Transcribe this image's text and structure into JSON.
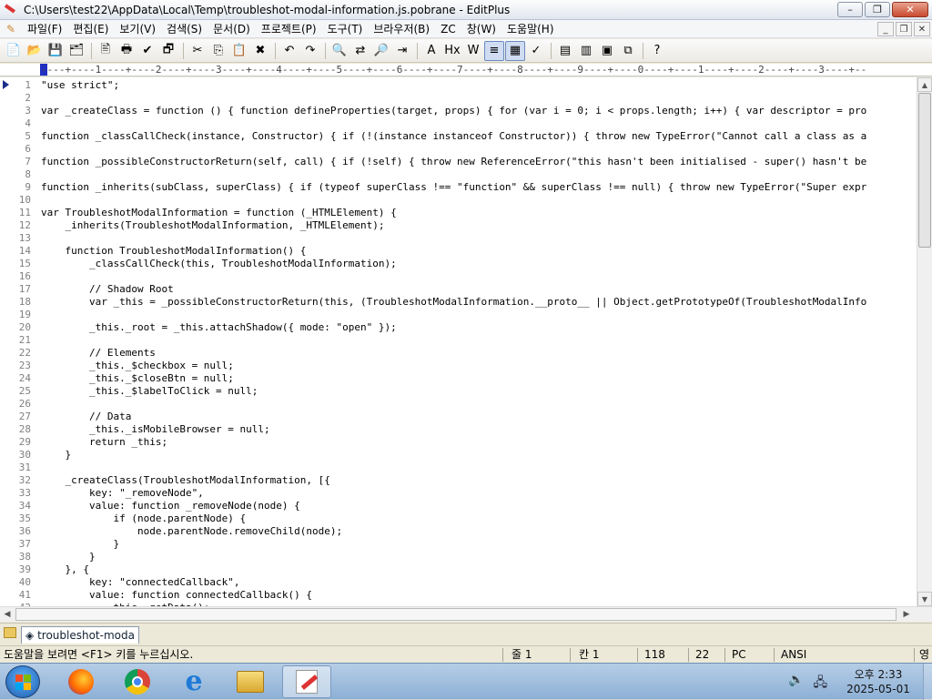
{
  "window": {
    "title": "C:\\Users\\test22\\AppData\\Local\\Temp\\troubleshot-modal-information.js.pobrane - EditPlus",
    "controls": {
      "minimize": "–",
      "maximize": "❐",
      "close": "✕"
    }
  },
  "menu": {
    "items": [
      "파일(F)",
      "편집(E)",
      "보기(V)",
      "검색(S)",
      "문서(D)",
      "프로젝트(P)",
      "도구(T)",
      "브라우저(B)",
      "ZC",
      "창(W)",
      "도움말(H)"
    ]
  },
  "mdi_controls": {
    "minimize": "_",
    "restore": "❐",
    "close": "✕"
  },
  "toolbar": {
    "buttons": [
      {
        "name": "new-file",
        "glyph": "📄"
      },
      {
        "name": "open-file",
        "glyph": "📂"
      },
      {
        "name": "save",
        "glyph": "💾"
      },
      {
        "name": "save-all",
        "glyph": "🗂"
      },
      {
        "name": "print-preview",
        "glyph": "🖹"
      },
      {
        "name": "print",
        "glyph": "🖶"
      },
      {
        "name": "spellcheck",
        "glyph": "✔"
      },
      {
        "name": "browser-view",
        "glyph": "🗗"
      },
      {
        "name": "cut",
        "glyph": "✂"
      },
      {
        "name": "copy",
        "glyph": "⎘"
      },
      {
        "name": "paste",
        "glyph": "📋"
      },
      {
        "name": "delete",
        "glyph": "✖"
      },
      {
        "name": "undo",
        "glyph": "↶"
      },
      {
        "name": "redo",
        "glyph": "↷"
      },
      {
        "name": "find",
        "glyph": "🔍"
      },
      {
        "name": "replace",
        "glyph": "⇄"
      },
      {
        "name": "find-in-files",
        "glyph": "🔎"
      },
      {
        "name": "goto",
        "glyph": "⇥"
      },
      {
        "name": "font",
        "glyph": "A"
      },
      {
        "name": "hex",
        "glyph": "Hx"
      },
      {
        "name": "word-wrap",
        "glyph": "W"
      },
      {
        "name": "line-number",
        "glyph": "≡"
      },
      {
        "name": "column-select",
        "glyph": "▦"
      },
      {
        "name": "check",
        "glyph": "✓"
      },
      {
        "name": "cliptext",
        "glyph": "▤"
      },
      {
        "name": "directory",
        "glyph": "▥"
      },
      {
        "name": "output",
        "glyph": "▣"
      },
      {
        "name": "fullscreen",
        "glyph": "⧉"
      },
      {
        "name": "help",
        "glyph": "?"
      }
    ]
  },
  "ruler": "----+----1----+----2----+----3----+----4----+----5----+----6----+----7----+----8----+----9----+----0----+----1----+----2----+----3----+--",
  "editor": {
    "lines": [
      {
        "n": "1",
        "t": "\"use strict\";"
      },
      {
        "n": "2",
        "t": ""
      },
      {
        "n": "3",
        "t": "var _createClass = function () { function defineProperties(target, props) { for (var i = 0; i < props.length; i++) { var descriptor = pro"
      },
      {
        "n": "4",
        "t": ""
      },
      {
        "n": "5",
        "t": "function _classCallCheck(instance, Constructor) { if (!(instance instanceof Constructor)) { throw new TypeError(\"Cannot call a class as a"
      },
      {
        "n": "6",
        "t": ""
      },
      {
        "n": "7",
        "t": "function _possibleConstructorReturn(self, call) { if (!self) { throw new ReferenceError(\"this hasn't been initialised - super() hasn't be"
      },
      {
        "n": "8",
        "t": ""
      },
      {
        "n": "9",
        "t": "function _inherits(subClass, superClass) { if (typeof superClass !== \"function\" && superClass !== null) { throw new TypeError(\"Super expr"
      },
      {
        "n": "10",
        "t": ""
      },
      {
        "n": "11",
        "t": "var TroubleshotModalInformation = function (_HTMLElement) {"
      },
      {
        "n": "12",
        "t": "    _inherits(TroubleshotModalInformation, _HTMLElement);"
      },
      {
        "n": "13",
        "t": ""
      },
      {
        "n": "14",
        "t": "    function TroubleshotModalInformation() {"
      },
      {
        "n": "15",
        "t": "        _classCallCheck(this, TroubleshotModalInformation);"
      },
      {
        "n": "16",
        "t": ""
      },
      {
        "n": "17",
        "t": "        // Shadow Root"
      },
      {
        "n": "18",
        "t": "        var _this = _possibleConstructorReturn(this, (TroubleshotModalInformation.__proto__ || Object.getPrototypeOf(TroubleshotModalInfo"
      },
      {
        "n": "19",
        "t": ""
      },
      {
        "n": "20",
        "t": "        _this._root = _this.attachShadow({ mode: \"open\" });"
      },
      {
        "n": "21",
        "t": ""
      },
      {
        "n": "22",
        "t": "        // Elements"
      },
      {
        "n": "23",
        "t": "        _this._$checkbox = null;"
      },
      {
        "n": "24",
        "t": "        _this._$closeBtn = null;"
      },
      {
        "n": "25",
        "t": "        _this._$labelToClick = null;"
      },
      {
        "n": "26",
        "t": ""
      },
      {
        "n": "27",
        "t": "        // Data"
      },
      {
        "n": "28",
        "t": "        _this._isMobileBrowser = null;"
      },
      {
        "n": "29",
        "t": "        return _this;"
      },
      {
        "n": "30",
        "t": "    }"
      },
      {
        "n": "31",
        "t": ""
      },
      {
        "n": "32",
        "t": "    _createClass(TroubleshotModalInformation, [{"
      },
      {
        "n": "33",
        "t": "        key: \"_removeNode\","
      },
      {
        "n": "34",
        "t": "        value: function _removeNode(node) {"
      },
      {
        "n": "35",
        "t": "            if (node.parentNode) {"
      },
      {
        "n": "36",
        "t": "                node.parentNode.removeChild(node);"
      },
      {
        "n": "37",
        "t": "            }"
      },
      {
        "n": "38",
        "t": "        }"
      },
      {
        "n": "39",
        "t": "    }, {"
      },
      {
        "n": "40",
        "t": "        key: \"connectedCallback\","
      },
      {
        "n": "41",
        "t": "        value: function connectedCallback() {"
      },
      {
        "n": "42",
        "t": "            this._getData();"
      }
    ]
  },
  "scroll": {
    "up": "▲",
    "down": "▼",
    "left": "◀",
    "right": "▶"
  },
  "doc_tab": {
    "label": "troubleshot-moda"
  },
  "status": {
    "help": "도움말을 보려면 <F1> 키를 누르십시오.",
    "line": "줄 1",
    "col": "칸 1",
    "total_lines": "118",
    "value": "22",
    "filetype": "PC",
    "encoding": "ANSI",
    "ime": "영"
  },
  "taskbar": {
    "apps": [
      "firefox",
      "chrome",
      "internet-explorer",
      "file-explorer",
      "editplus"
    ],
    "tray_icons": [
      "volume",
      "network"
    ],
    "clock_time": "오후 2:33",
    "clock_date": "2025-05-01"
  },
  "colors": {
    "accent": "#1a2e8a",
    "title_bar": "#e1e6ee",
    "taskbar": "#8cb0d6"
  }
}
